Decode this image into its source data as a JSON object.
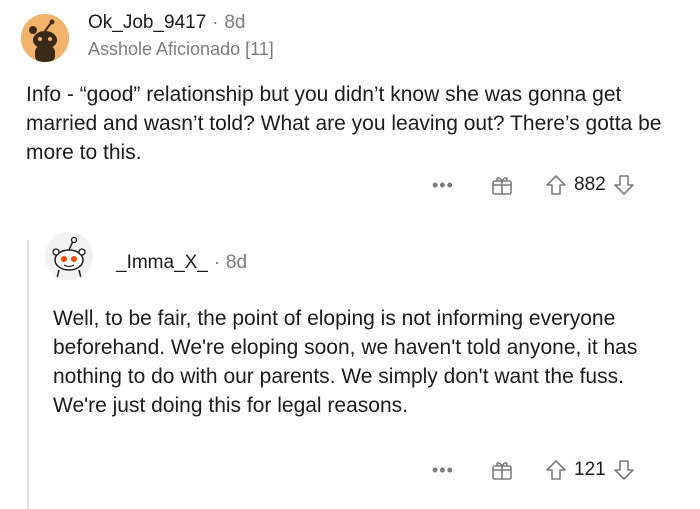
{
  "comments": [
    {
      "username": "Ok_Job_9417",
      "separator": "·",
      "age": "8d",
      "flair": "Asshole Aficionado [11]",
      "body": "Info - “good” relationship but you didn’t know she was gonna get married and wasn’t told? What are you leaving out? There’s gotta be more to this.",
      "more_label": "•••",
      "score": "882",
      "icons": {
        "more": "more-icon",
        "award": "gift-icon",
        "upvote": "upvote-icon",
        "downvote": "downvote-icon"
      }
    },
    {
      "username": "_Imma_X_",
      "separator": "·",
      "age": "8d",
      "body": "Well, to be fair, the point of eloping is not informing everyone beforehand. We're eloping soon, we haven't told anyone, it has nothing to do with our parents. We simply don't want the fuss. We're just doing this for legal reasons.",
      "more_label": "•••",
      "score": "121",
      "icons": {
        "more": "more-icon",
        "award": "gift-icon",
        "upvote": "upvote-icon",
        "downvote": "downvote-icon"
      }
    }
  ],
  "colors": {
    "avatar1": "#f2b36b",
    "muted": "#7c7c7c",
    "text": "#1c1c1c",
    "thread_line": "#e5e5e5"
  }
}
